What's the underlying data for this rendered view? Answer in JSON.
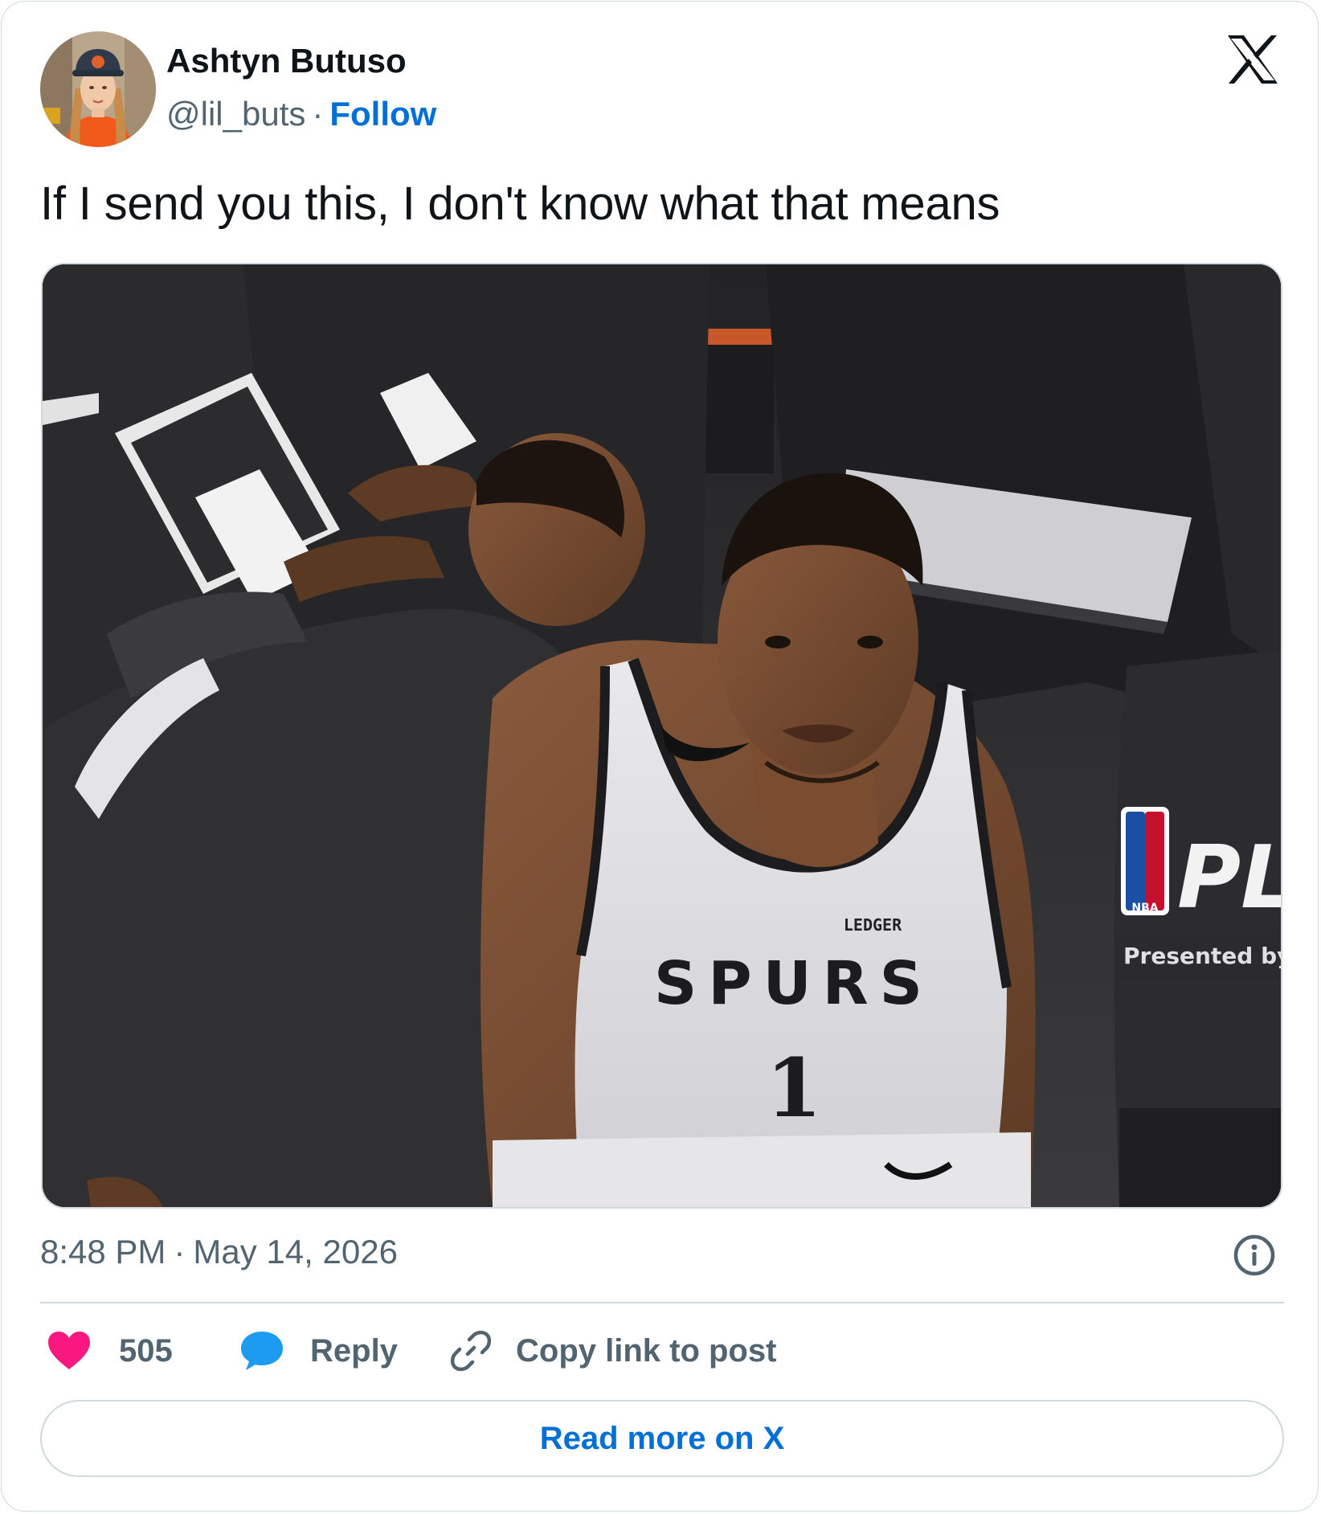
{
  "author": {
    "name": "Ashtyn Butuso",
    "handle": "@lil_buts",
    "separator": "·",
    "follow_label": "Follow",
    "avatar_icon": "profile-photo"
  },
  "platform": {
    "logo_icon": "x-logo"
  },
  "tweet": {
    "text": "If I send you this, I don't know what that means",
    "media_description_icon": "basketball-photo",
    "media_jersey": {
      "team": "SPURS",
      "number": "1",
      "sponsor": "LEDGER"
    },
    "media_banner": {
      "logo": "NBA",
      "headline": "PLA",
      "sub": "Presented by Goo"
    }
  },
  "meta": {
    "time": "8:48 PM",
    "separator": "·",
    "date": "May 14, 2026",
    "info_icon": "info-icon"
  },
  "actions": {
    "like_count": "505",
    "reply_label": "Reply",
    "copy_label": "Copy link to post"
  },
  "footer": {
    "read_more_label": "Read more on X"
  },
  "colors": {
    "link_blue": "#006fd6",
    "like_pink": "#f91880",
    "reply_blue": "#1d9bf0",
    "muted": "#536471",
    "border": "#cfd9de"
  }
}
